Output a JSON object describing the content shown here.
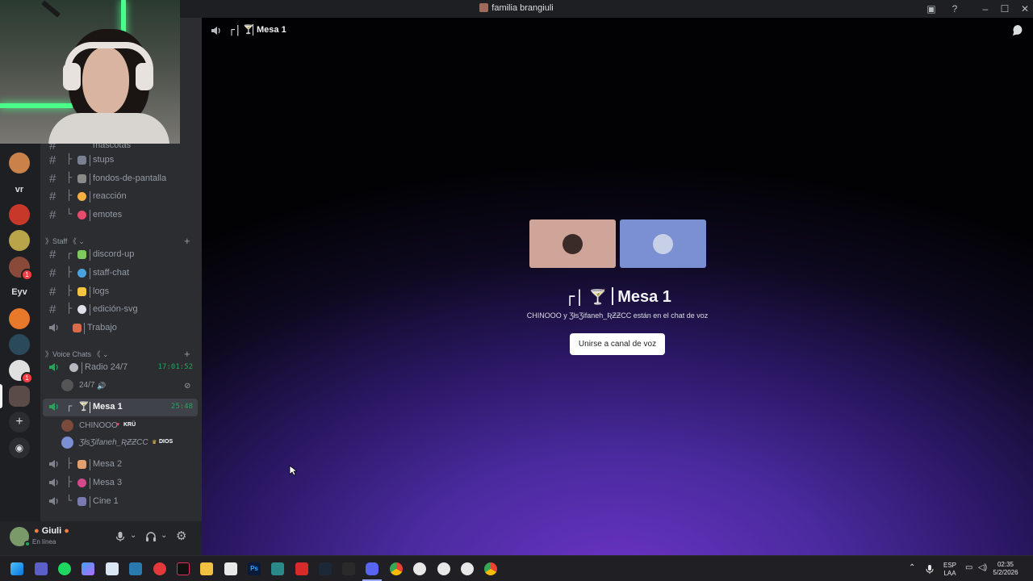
{
  "window": {
    "title": "familia brangiuli"
  },
  "rail": {
    "text_items": [
      "vr",
      "Eyv"
    ],
    "badges": [
      "1",
      "1",
      "1"
    ]
  },
  "channels": {
    "partial_top": "mascotas",
    "text": [
      {
        "name": "stups",
        "tree": "├",
        "emoji_color": "#7a8090"
      },
      {
        "name": "fondos-de-pantalla",
        "tree": "├",
        "emoji_color": "#8a8a8a"
      },
      {
        "name": "reacción",
        "tree": "├",
        "emoji_color": "#f5b042"
      },
      {
        "name": "emotes",
        "tree": "└",
        "emoji_color": "#e84b6b"
      }
    ],
    "staff_category": "Staff",
    "staff": [
      {
        "name": "discord-up",
        "tree": "┌",
        "emoji_color": "#7dc95e"
      },
      {
        "name": "staff-chat",
        "tree": "├",
        "emoji_color": "#4aa3df"
      },
      {
        "name": "logs",
        "tree": "├",
        "emoji_color": "#f5c542"
      },
      {
        "name": "edición-svg",
        "tree": "├",
        "emoji_color": "#e0e0e8"
      },
      {
        "name": "Trabajo",
        "tree": "└",
        "emoji_color": "#d96a4a"
      }
    ],
    "voice_category": "Voice Chats",
    "radio": {
      "name": "Radio 24/7",
      "timer": "17:01:52",
      "listener": "24/7"
    },
    "mesa1": {
      "name": "Mesa 1",
      "timer": "25:48",
      "users": [
        {
          "name": "CHINOOO",
          "tag": "KRÜ",
          "tag_color": "#e84b6b"
        },
        {
          "name": "ƷłsƷifaneh_ƦƵƵCC",
          "tag": "DIOS",
          "tag_color": "#f5c542"
        }
      ]
    },
    "other_voice": [
      {
        "name": "Mesa 2",
        "tree": "├",
        "emoji_color": "#e0a070"
      },
      {
        "name": "Mesa 3",
        "tree": "├",
        "emoji_color": "#d44a8a"
      },
      {
        "name": "Cine 1",
        "tree": "└",
        "emoji_color": "#7a7ab0"
      }
    ]
  },
  "user_panel": {
    "name": "Giuli",
    "status": "En línea"
  },
  "main": {
    "header_title": "Mesa 1",
    "header_prefix": "┌|",
    "title_prefix": "┌|",
    "title_name": "Mesa 1",
    "subtitle": "CHINOOO y ƷłsƷifaneh_ƦƵƵCC están en el chat de voz",
    "join_button": "Unirse a canal de voz"
  },
  "tray": {
    "lang1": "ESP",
    "lang2": "LAA",
    "time": "02:35",
    "date": "5/2/2026",
    "ps_label": "Ps"
  },
  "colors": {
    "online": "#23a55a",
    "accent": "#5865f2",
    "danger": "#f23f43",
    "tile_left": "#cfa59a",
    "tile_right": "#7b8fd3"
  }
}
